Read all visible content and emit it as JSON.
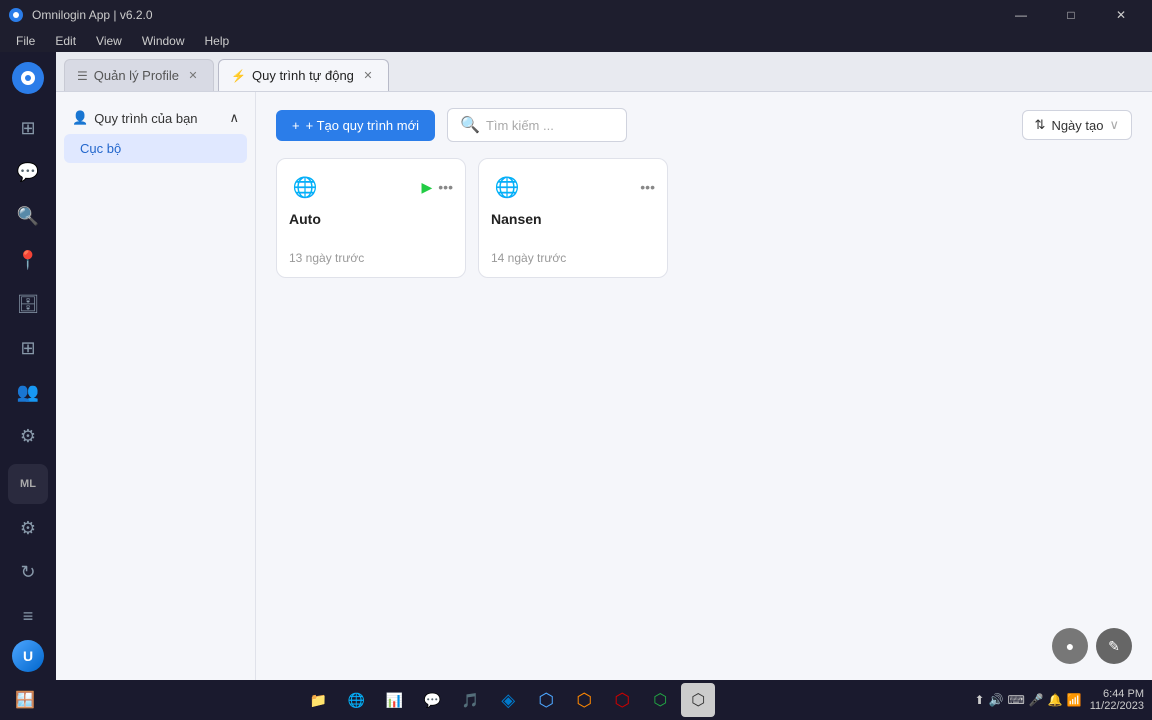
{
  "titlebar": {
    "title": "Omnilogin App | v6.2.0",
    "controls": {
      "minimize": "—",
      "maximize": "□",
      "close": "✕"
    }
  },
  "menubar": {
    "items": [
      "File",
      "Edit",
      "View",
      "Window",
      "Help"
    ]
  },
  "tabs": [
    {
      "id": "tab-quan-ly-profile",
      "label": "Quản lý Profile",
      "icon": "☰",
      "active": false,
      "closable": true
    },
    {
      "id": "tab-quy-trinh-tu-dong",
      "label": "Quy trình tự động",
      "icon": "⚡",
      "active": true,
      "closable": true
    }
  ],
  "sidebar": {
    "items": [
      {
        "id": "home",
        "icon": "⊞",
        "label": "Home"
      },
      {
        "id": "chat",
        "icon": "💬",
        "label": "Chat"
      },
      {
        "id": "search",
        "icon": "🔍",
        "label": "Search"
      },
      {
        "id": "location",
        "icon": "📍",
        "label": "Location"
      },
      {
        "id": "database",
        "icon": "🗄",
        "label": "Database"
      },
      {
        "id": "grid",
        "icon": "⊞",
        "label": "Grid"
      },
      {
        "id": "users",
        "icon": "👥",
        "label": "Users"
      },
      {
        "id": "settings2",
        "icon": "⚙",
        "label": "Settings"
      }
    ],
    "bottom_items": [
      {
        "id": "ml",
        "icon": "ML",
        "label": "ML"
      },
      {
        "id": "gear",
        "icon": "⚙",
        "label": "Gear"
      },
      {
        "id": "refresh",
        "icon": "↻",
        "label": "Refresh"
      },
      {
        "id": "menu",
        "icon": "≡",
        "label": "Menu"
      }
    ],
    "avatar": {
      "label": "U",
      "tooltip": "User profile"
    }
  },
  "left_panel": {
    "section": {
      "header": "Quy trình của bạn",
      "icon": "👤",
      "collapsed": false
    },
    "items": [
      {
        "id": "local",
        "label": "Cục bộ",
        "active": true
      }
    ]
  },
  "toolbar": {
    "create_button": "+ Tạo quy trình mới",
    "search_placeholder": "Tìm kiếm ...",
    "sort_label": "Ngày tạo",
    "sort_icon": "⇅"
  },
  "cards": [
    {
      "id": "card-auto",
      "name": "Auto",
      "icon": "🌐",
      "time_ago": "13 ngày trước",
      "has_play": true,
      "has_more": true
    },
    {
      "id": "card-nansen",
      "name": "Nansen",
      "icon": "🌐",
      "time_ago": "14 ngày trước",
      "has_play": false,
      "has_more": true
    }
  ],
  "taskbar": {
    "time": "6:44 PM",
    "date": "11/22/2023",
    "apps": [
      "🪟",
      "📁",
      "🌐",
      "📊",
      "💬",
      "🎵",
      "⚙",
      "🔷",
      "🔶",
      "🔴",
      "🟢",
      "🔵"
    ],
    "system_icons": [
      "🔔",
      "🔊",
      "📶",
      "⌨"
    ]
  },
  "floating_buttons": [
    {
      "id": "circle-btn",
      "icon": "●"
    },
    {
      "id": "edit-btn",
      "icon": "✎"
    }
  ]
}
